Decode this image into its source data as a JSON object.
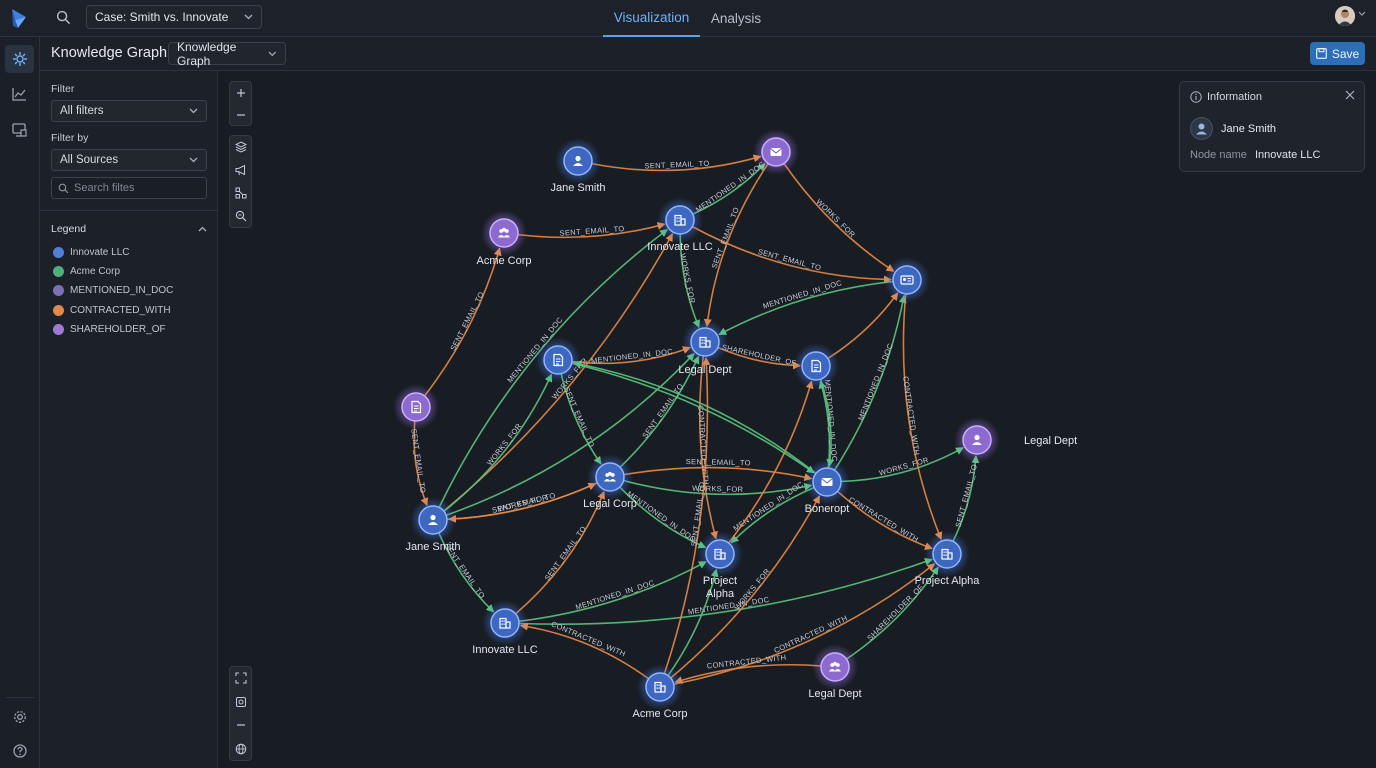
{
  "header": {
    "case_select": "Case: Smith vs. Innovate",
    "tabs": [
      "Visualization",
      "Analysis"
    ],
    "active_tab": "Visualization"
  },
  "subheader": {
    "title": "Knowledge Graph",
    "view_select": "Knowledge Graph",
    "save_label": "Save"
  },
  "sidebar": {
    "filter_label": "Filter",
    "filter_value": "All filters",
    "filter_by_label": "Filter by",
    "filter_by_value": "All Sources",
    "search_placeholder": "Search filtes",
    "legend_title": "Legend",
    "legend": [
      {
        "label": "Innovate LLC",
        "color": "#4f7fd6"
      },
      {
        "label": "Acme Corp",
        "color": "#4fae7d"
      },
      {
        "label": "MENTIONED_IN_DOC",
        "color": "#7d6fb0"
      },
      {
        "label": "CONTRACTED_WITH",
        "color": "#e0894a"
      },
      {
        "label": "SHAREHOLDER_OF",
        "color": "#a07ad0"
      }
    ]
  },
  "info_panel": {
    "title": "Information",
    "entity_name": "Jane Smith",
    "field_key": "Node name",
    "field_value": "Innovate LLC"
  },
  "colors": {
    "accent": "#5aa0ea",
    "edge_orange": "#e58a48",
    "edge_green": "#5cc47f",
    "node_blue": "#3d67c0",
    "node_purple": "#8d6ad0"
  },
  "graph": {
    "nodes": [
      {
        "id": "n1",
        "label": "Jane Smith",
        "kind": "blue",
        "icon": "person-icon"
      },
      {
        "id": "n2",
        "label": "",
        "kind": "purple",
        "icon": "envelope-icon"
      },
      {
        "id": "n3",
        "label": "Acme Corp",
        "kind": "purple",
        "icon": "group-icon"
      },
      {
        "id": "n4",
        "label": "Innovate LLC",
        "kind": "blue",
        "icon": "building-icon"
      },
      {
        "id": "n5",
        "label": "",
        "kind": "blue",
        "icon": "id-card-icon"
      },
      {
        "id": "n6",
        "label": "",
        "kind": "blue",
        "icon": "document-icon"
      },
      {
        "id": "n7",
        "label": "Legal Dept",
        "kind": "blue",
        "icon": "building-icon"
      },
      {
        "id": "n8",
        "label": "",
        "kind": "blue",
        "icon": "document-icon"
      },
      {
        "id": "n9",
        "label": "",
        "kind": "purple",
        "icon": "document-icon"
      },
      {
        "id": "n10",
        "label": "Legal Dept",
        "kind": "purple",
        "icon": "person-icon"
      },
      {
        "id": "n11",
        "label": "Legal Corp",
        "kind": "blue",
        "icon": "group-icon"
      },
      {
        "id": "n12",
        "label": "Boneropt",
        "kind": "blue",
        "icon": "envelope-icon"
      },
      {
        "id": "n13",
        "label": "Jane Smith",
        "kind": "blue",
        "icon": "person-icon"
      },
      {
        "id": "n14",
        "label": "Project Alpha",
        "kind": "blue",
        "icon": "building-icon"
      },
      {
        "id": "n15",
        "label": "Project Alpha",
        "kind": "blue",
        "icon": "building-icon"
      },
      {
        "id": "n16",
        "label": "Innovate LLC",
        "kind": "blue",
        "icon": "building-icon"
      },
      {
        "id": "n17",
        "label": "Legal Dept",
        "kind": "purple",
        "icon": "group-icon"
      },
      {
        "id": "n18",
        "label": "Acme Corp",
        "kind": "blue",
        "icon": "building-icon"
      }
    ],
    "edges": [
      {
        "from": "n1",
        "to": "n2",
        "color": "orange",
        "label": "SENT_EMAIL_TO"
      },
      {
        "from": "n3",
        "to": "n4",
        "color": "orange",
        "label": "SENT_EMAIL_TO"
      },
      {
        "from": "n4",
        "to": "n2",
        "color": "green",
        "label": "MENTIONED_IN_DOC"
      },
      {
        "from": "n4",
        "to": "n5",
        "color": "orange",
        "label": "SENT_EMAIL_TO"
      },
      {
        "from": "n2",
        "to": "n5",
        "color": "orange",
        "label": "WORKS_FOR"
      },
      {
        "from": "n4",
        "to": "n7",
        "color": "green",
        "label": "WORKS_FOR"
      },
      {
        "from": "n2",
        "to": "n7",
        "color": "orange",
        "label": "SENT_EMAIL_TO"
      },
      {
        "from": "n9",
        "to": "n3",
        "color": "orange",
        "label": "SENT_EMAIL_TO"
      },
      {
        "from": "n13",
        "to": "n4",
        "color": "orange",
        "label": "WORKS_FOR"
      },
      {
        "from": "n13",
        "to": "n4",
        "color": "green",
        "label": "MENTIONED_IN_DOC"
      },
      {
        "from": "n5",
        "to": "n7",
        "color": "green",
        "label": "MENTIONED_IN_DOC"
      },
      {
        "from": "n8",
        "to": "n5",
        "color": "orange",
        "label": ""
      },
      {
        "from": "n6",
        "to": "n7",
        "color": "orange",
        "label": "MENTIONED_IN_DOC"
      },
      {
        "from": "n7",
        "to": "n8",
        "color": "orange",
        "label": "SHAREHOLDER_OF"
      },
      {
        "from": "n6",
        "to": "n11",
        "color": "green",
        "label": "SENT_EMAIL_TO"
      },
      {
        "from": "n13",
        "to": "n6",
        "color": "green",
        "label": "WORKS_FOR"
      },
      {
        "from": "n11",
        "to": "n7",
        "color": "green",
        "label": "SENT_EMAIL_TO"
      },
      {
        "from": "n7",
        "to": "n15",
        "color": "orange",
        "label": "CONTRACTED_WITH"
      },
      {
        "from": "n9",
        "to": "n13",
        "color": "orange",
        "label": "SENT_EMAIL_TO"
      },
      {
        "from": "n13",
        "to": "n11",
        "color": "orange",
        "label": "WORKS_FOR"
      },
      {
        "from": "n11",
        "to": "n13",
        "color": "orange",
        "label": "SENT_EMAIL_TO"
      },
      {
        "from": "n11",
        "to": "n12",
        "color": "green",
        "label": "WORKS_FOR"
      },
      {
        "from": "n11",
        "to": "n12",
        "color": "orange",
        "label": "SENT_EMAIL_TO"
      },
      {
        "from": "n11",
        "to": "n15",
        "color": "green",
        "label": "MENTIONED_IN_DOC"
      },
      {
        "from": "n12",
        "to": "n6",
        "color": "green",
        "label": ""
      },
      {
        "from": "n12",
        "to": "n8",
        "color": "green",
        "label": "MENTIONED_IN_DOC"
      },
      {
        "from": "n12",
        "to": "n15",
        "color": "green",
        "label": "MENTIONED_IN_DOC"
      },
      {
        "from": "n12",
        "to": "n10",
        "color": "green",
        "label": "WORKS_FOR"
      },
      {
        "from": "n12",
        "to": "n14",
        "color": "orange",
        "label": "CONTRACTED_WITH"
      },
      {
        "from": "n12",
        "to": "n5",
        "color": "green",
        "label": "MENTIONED_IN_DOC"
      },
      {
        "from": "n5",
        "to": "n14",
        "color": "orange",
        "label": "CONTRACTED_WITH"
      },
      {
        "from": "n14",
        "to": "n10",
        "color": "green",
        "label": "SENT_EMAIL_TO"
      },
      {
        "from": "n13",
        "to": "n16",
        "color": "green",
        "label": "SENT_EMAIL_TO"
      },
      {
        "from": "n16",
        "to": "n11",
        "color": "orange",
        "label": "SENT_EMAIL_TO"
      },
      {
        "from": "n16",
        "to": "n15",
        "color": "green",
        "label": "MENTIONED_IN_DOC"
      },
      {
        "from": "n16",
        "to": "n14",
        "color": "green",
        "label": "MENTIONED_IN_DOC"
      },
      {
        "from": "n18",
        "to": "n16",
        "color": "orange",
        "label": "CONTRACTED_WITH"
      },
      {
        "from": "n18",
        "to": "n7",
        "color": "orange",
        "label": "SENT_EMAIL_TO"
      },
      {
        "from": "n18",
        "to": "n12",
        "color": "orange",
        "label": "WORKS_FOR"
      },
      {
        "from": "n18",
        "to": "n14",
        "color": "orange",
        "label": "CONTRACTED_WITH"
      },
      {
        "from": "n17",
        "to": "n18",
        "color": "orange",
        "label": "CONTRACTED_WITH"
      },
      {
        "from": "n17",
        "to": "n14",
        "color": "green",
        "label": "SHAREHOLDER_OF"
      },
      {
        "from": "n8",
        "to": "n12",
        "color": "green",
        "label": ""
      },
      {
        "from": "n15",
        "to": "n8",
        "color": "orange",
        "label": ""
      },
      {
        "from": "n18",
        "to": "n15",
        "color": "green",
        "label": ""
      },
      {
        "from": "n13",
        "to": "n7",
        "color": "green",
        "label": ""
      },
      {
        "from": "n6",
        "to": "n12",
        "color": "green",
        "label": ""
      }
    ]
  }
}
